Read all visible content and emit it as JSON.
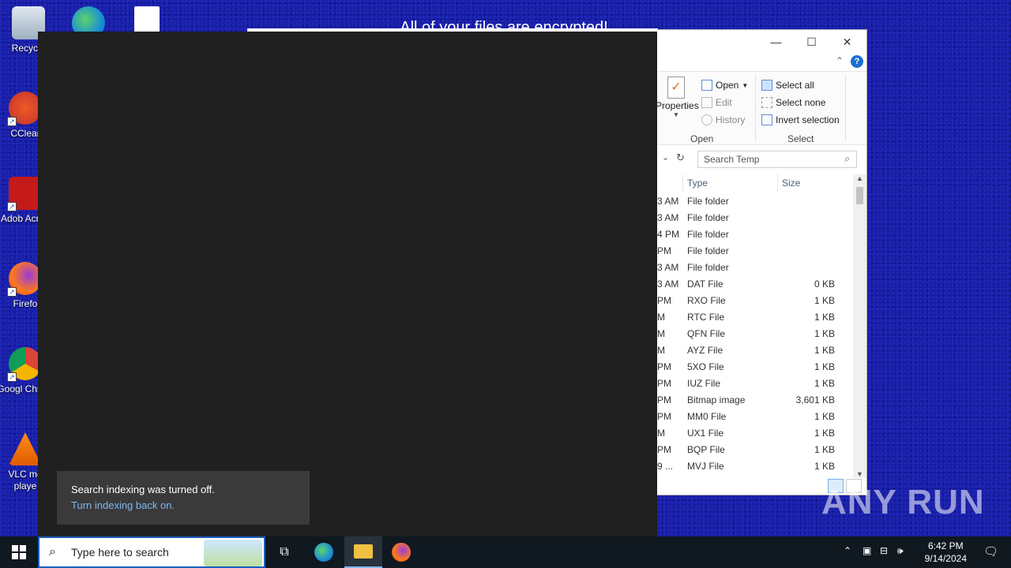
{
  "desktop": {
    "icons": [
      {
        "label": "Recycle",
        "icon": "recycle-bin-icon"
      },
      {
        "label": "CClear",
        "icon": "ccleaner-icon"
      },
      {
        "label": "Adob Acrob",
        "icon": "acrobat-icon"
      },
      {
        "label": "Firefo",
        "icon": "firefox-icon"
      },
      {
        "label": "Googl Chrom",
        "icon": "chrome-icon"
      },
      {
        "label": "VLC me playe",
        "icon": "vlc-icon"
      }
    ]
  },
  "note": {
    "title": "All of your files are encrypted!"
  },
  "explorer": {
    "ribbon": {
      "properties_label": "Properties",
      "open_label": "Open",
      "edit_label": "Edit",
      "history_label": "History",
      "select_all_label": "Select all",
      "select_none_label": "Select none",
      "invert_selection_label": "Invert selection",
      "group_open": "Open",
      "group_select": "Select"
    },
    "search_placeholder": "Search Temp",
    "columns": {
      "type": "Type",
      "size": "Size"
    },
    "rows": [
      {
        "date": "3 AM",
        "type": "File folder",
        "size": ""
      },
      {
        "date": "3 AM",
        "type": "File folder",
        "size": ""
      },
      {
        "date": "4 PM",
        "type": "File folder",
        "size": ""
      },
      {
        "date": "PM",
        "type": "File folder",
        "size": ""
      },
      {
        "date": "3 AM",
        "type": "File folder",
        "size": ""
      },
      {
        "date": "3 AM",
        "type": "DAT File",
        "size": "0 KB"
      },
      {
        "date": "PM",
        "type": "RXO File",
        "size": "1 KB"
      },
      {
        "date": "M",
        "type": "RTC File",
        "size": "1 KB"
      },
      {
        "date": "M",
        "type": "QFN File",
        "size": "1 KB"
      },
      {
        "date": "M",
        "type": "AYZ File",
        "size": "1 KB"
      },
      {
        "date": "PM",
        "type": "5XO File",
        "size": "1 KB"
      },
      {
        "date": "PM",
        "type": "IUZ File",
        "size": "1 KB"
      },
      {
        "date": "PM",
        "type": "Bitmap image",
        "size": "3,601 KB"
      },
      {
        "date": "PM",
        "type": "MM0 File",
        "size": "1 KB"
      },
      {
        "date": "M",
        "type": "UX1 File",
        "size": "1 KB"
      },
      {
        "date": "PM",
        "type": "BQP File",
        "size": "1 KB"
      },
      {
        "date": "9 ...",
        "type": "MVJ File",
        "size": "1 KB"
      }
    ]
  },
  "toast": {
    "message": "Search indexing was turned off.",
    "action": "Turn indexing back on."
  },
  "watermark": "ANY RUN",
  "taskbar": {
    "search_placeholder": "Type here to search",
    "time": "6:42 PM",
    "date": "9/14/2024"
  }
}
